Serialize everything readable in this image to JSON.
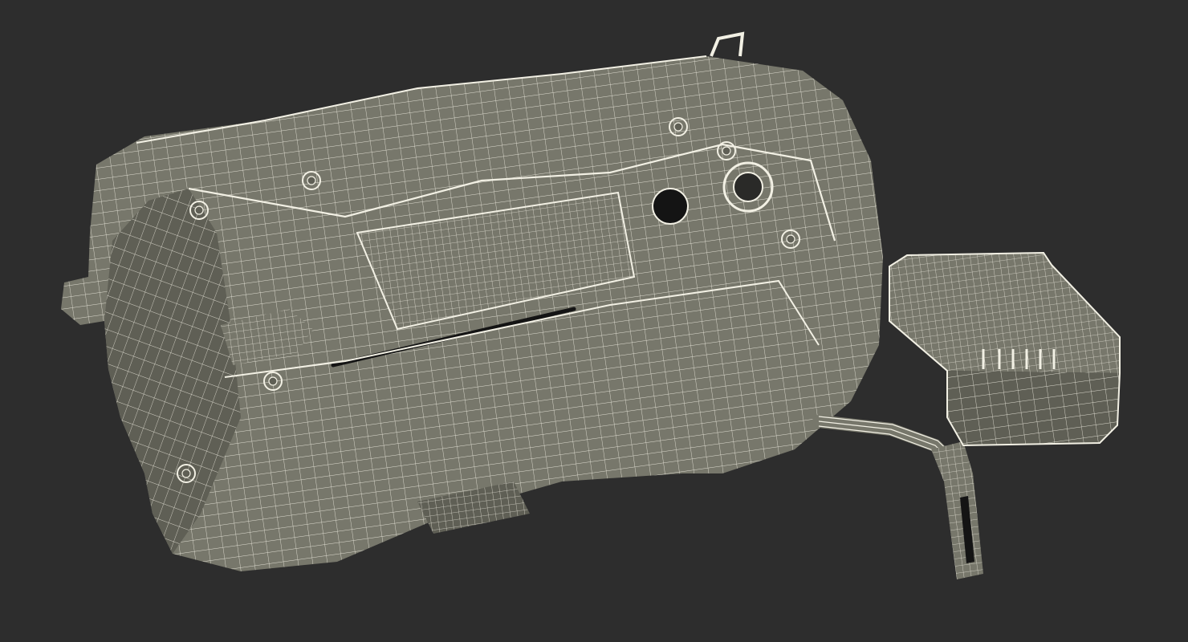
{
  "scene": {
    "background_color": "#2d2d2d",
    "surface_color": "#77776b",
    "surface_dark_color": "#5f5f55",
    "wire_color": "#f2f0e4",
    "hole_color": "#141414"
  },
  "objects": [
    {
      "name": "camcorder-body"
    },
    {
      "name": "battery-pack"
    },
    {
      "name": "ribbon-cable"
    },
    {
      "name": "cable-connector"
    }
  ]
}
